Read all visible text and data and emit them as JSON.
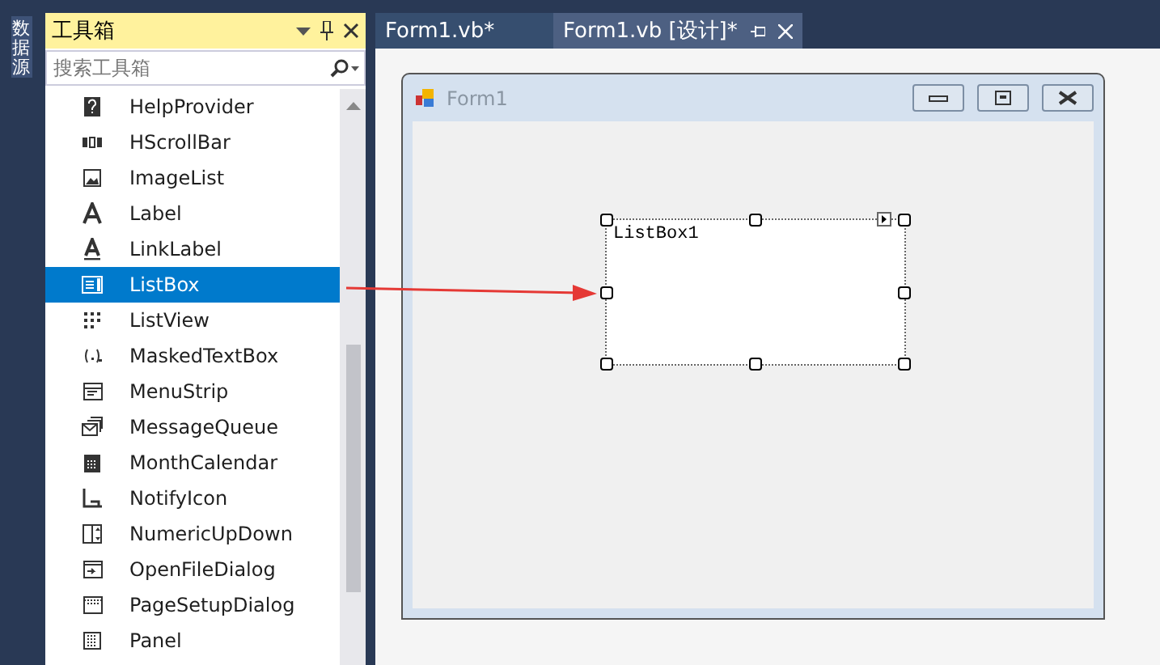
{
  "side_tab": {
    "label": "数据源"
  },
  "toolbox": {
    "title": "工具箱",
    "search": {
      "placeholder": "搜索工具箱"
    },
    "items": [
      {
        "label": "HelpProvider",
        "selected": false
      },
      {
        "label": "HScrollBar",
        "selected": false
      },
      {
        "label": "ImageList",
        "selected": false
      },
      {
        "label": "Label",
        "selected": false
      },
      {
        "label": "LinkLabel",
        "selected": false
      },
      {
        "label": "ListBox",
        "selected": true
      },
      {
        "label": "ListView",
        "selected": false
      },
      {
        "label": "MaskedTextBox",
        "selected": false
      },
      {
        "label": "MenuStrip",
        "selected": false
      },
      {
        "label": "MessageQueue",
        "selected": false
      },
      {
        "label": "MonthCalendar",
        "selected": false
      },
      {
        "label": "NotifyIcon",
        "selected": false
      },
      {
        "label": "NumericUpDown",
        "selected": false
      },
      {
        "label": "OpenFileDialog",
        "selected": false
      },
      {
        "label": "PageSetupDialog",
        "selected": false
      },
      {
        "label": "Panel",
        "selected": false
      }
    ]
  },
  "tabs": [
    {
      "label": "Form1.vb*",
      "selected": false
    },
    {
      "label": "Form1.vb [设计]*",
      "selected": true
    }
  ],
  "form": {
    "title": "Form1",
    "listbox": {
      "text": "ListBox1"
    }
  }
}
